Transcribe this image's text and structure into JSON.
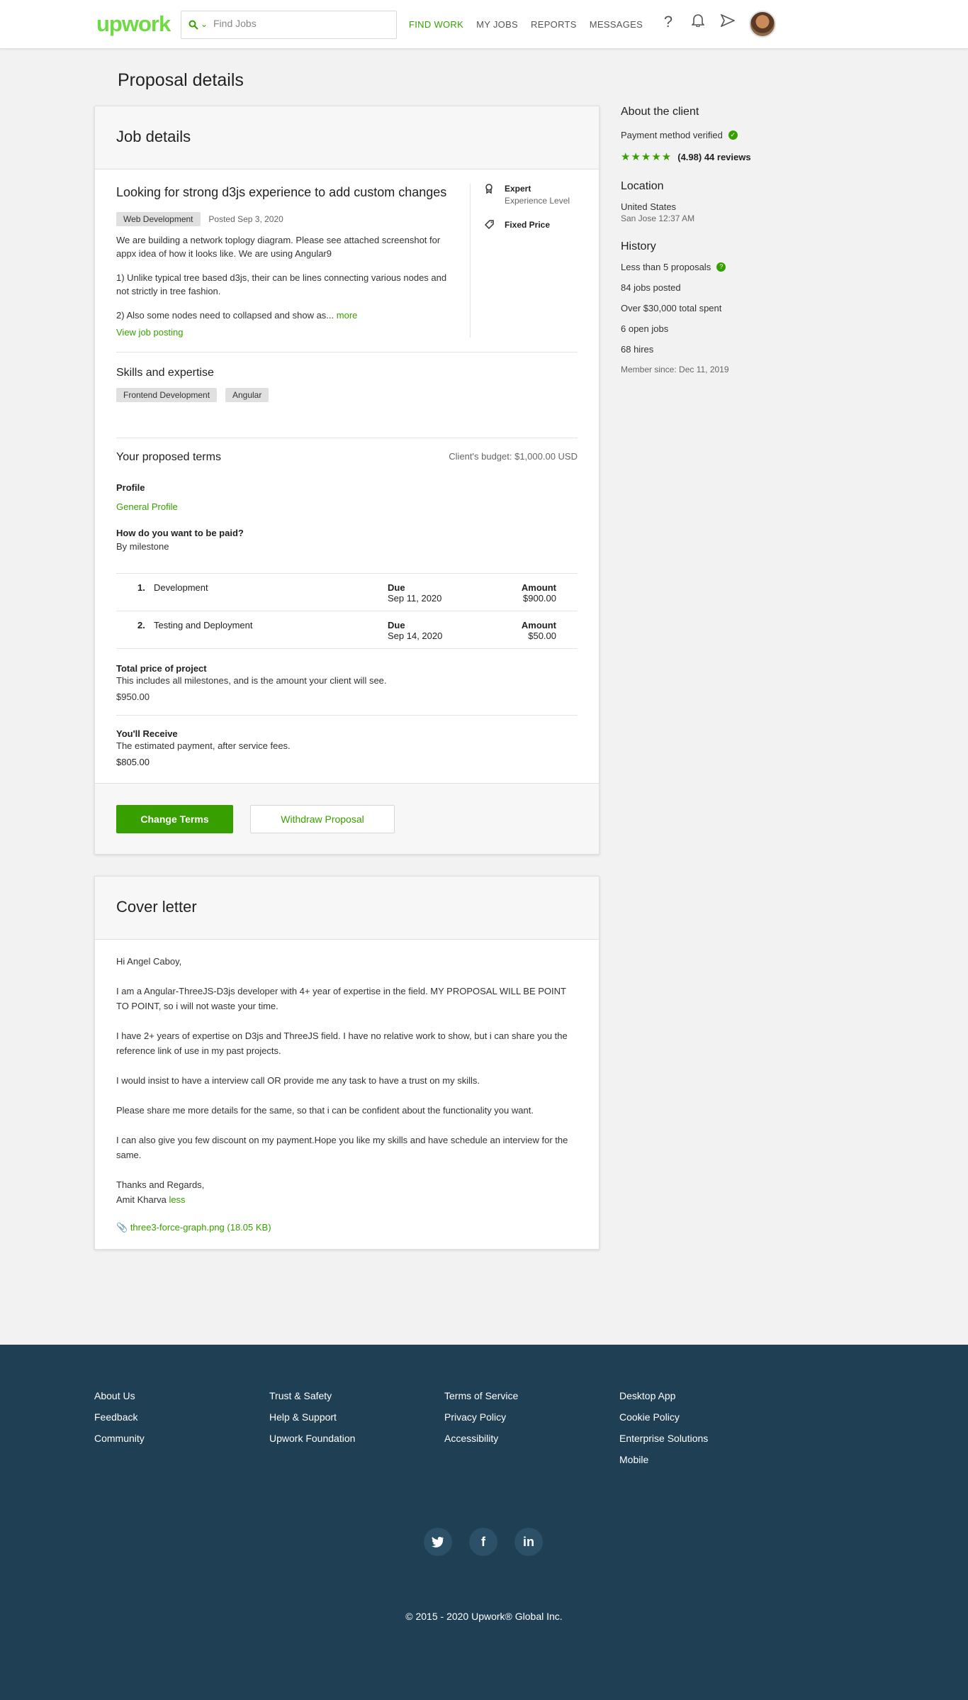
{
  "header": {
    "logo": "upwork",
    "search_placeholder": "Find Jobs",
    "nav": [
      "FIND WORK",
      "MY JOBS",
      "REPORTS",
      "MESSAGES"
    ]
  },
  "page_title": "Proposal details",
  "job_details": {
    "heading": "Job details",
    "title": "Looking for strong d3js experience to add custom changes",
    "category": "Web Development",
    "posted": "Posted Sep 3, 2020",
    "desc": [
      "We are building a network toplogy diagram. Please see attached screenshot for appx idea of how it looks like. We are using Angular9",
      "1) Unlike typical tree based d3js, their can be lines connecting various nodes and not strictly in tree fashion.",
      "2) Also some nodes need to collapsed and show as..."
    ],
    "more": "more",
    "view_posting": "View job posting",
    "level": "Expert",
    "level_sub": "Experience Level",
    "type": "Fixed Price",
    "skills_heading": "Skills and expertise",
    "skills": [
      "Frontend Development",
      "Angular"
    ]
  },
  "terms": {
    "heading": "Your proposed terms",
    "budget": "Client's budget: $1,000.00 USD",
    "profile_label": "Profile",
    "profile_value": "General Profile",
    "paid_label": "How do you want to be paid?",
    "paid_value": "By milestone",
    "milestones": [
      {
        "num": "1.",
        "name": "Development",
        "due_label": "Due",
        "due": "Sep 11, 2020",
        "amount_label": "Amount",
        "amount": "$900.00"
      },
      {
        "num": "2.",
        "name": "Testing and Deployment",
        "due_label": "Due",
        "due": "Sep 14, 2020",
        "amount_label": "Amount",
        "amount": "$50.00"
      }
    ],
    "total_label": "Total price of project",
    "total_desc": "This includes all milestones, and is the amount your client will see.",
    "total_value": "$950.00",
    "receive_label": "You'll Receive",
    "receive_desc": "The estimated payment, after service fees.",
    "receive_value": "$805.00",
    "change_btn": "Change Terms",
    "withdraw_btn": "Withdraw Proposal"
  },
  "cover": {
    "heading": "Cover letter",
    "greeting": "Hi Angel Caboy,",
    "paras": [
      "I am a Angular-ThreeJS-D3js developer with 4+ year of expertise in the field. MY PROPOSAL WILL BE POINT TO POINT, so i will not waste your time.",
      "I have 2+ years of expertise on D3js and ThreeJS field. I have no relative work to show, but i can share you the reference link of use in my past projects.",
      "I would insist to have a interview call OR provide me any task to have a trust on my skills.",
      "Please share me more details for the same, so that i can be confident about the functionality you want.",
      "I can also give you few discount on my payment.Hope you like my skills and have schedule an interview for the same."
    ],
    "closing": "Thanks and Regards,",
    "name": "Amit Kharva",
    "less": "less",
    "attachment": "three3-force-graph.png (18.05 KB)"
  },
  "client": {
    "heading": "About the client",
    "payment": "Payment method verified",
    "rating": "(4.98) 44 reviews",
    "location_heading": "Location",
    "country": "United States",
    "city_time": "San Jose 12:37 AM",
    "history_heading": "History",
    "proposals": "Less than 5 proposals",
    "jobs_posted": "84 jobs posted",
    "spent": "Over $30,000 total spent",
    "open_jobs": "6 open jobs",
    "hires": "68 hires",
    "member_since": "Member since: Dec 11, 2019"
  },
  "footer": {
    "cols": [
      [
        "About Us",
        "Feedback",
        "Community"
      ],
      [
        "Trust & Safety",
        "Help & Support",
        "Upwork Foundation"
      ],
      [
        "Terms of Service",
        "Privacy Policy",
        "Accessibility"
      ],
      [
        "Desktop App",
        "Cookie Policy",
        "Enterprise Solutions",
        "Mobile"
      ]
    ],
    "copyright": "© 2015 - 2020 Upwork® Global Inc."
  },
  "colors": {
    "accent": "#37a000",
    "footer_bg": "#1e3f54"
  }
}
